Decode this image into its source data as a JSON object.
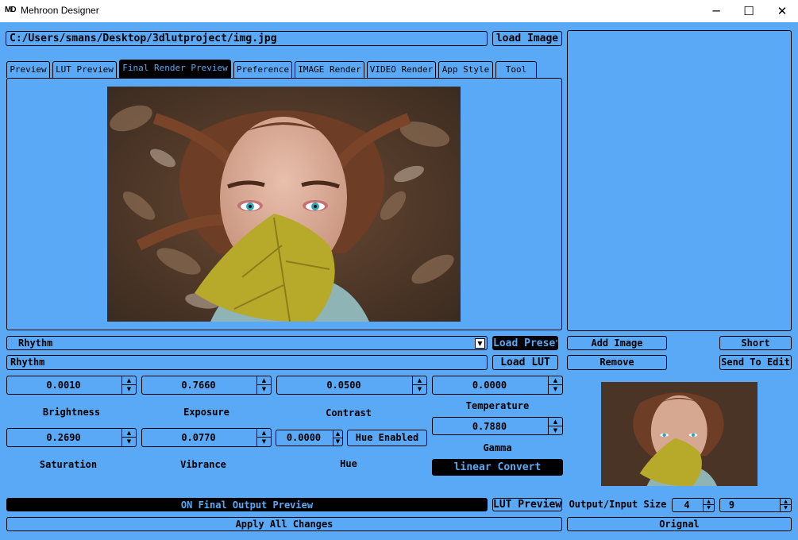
{
  "window": {
    "logo": "MD",
    "title": "Mehroon Designer",
    "minimize": "─",
    "maximize": "☐",
    "close": "✕"
  },
  "path": {
    "value": "C:/Users/smans/Desktop/3dlutproject/img.jpg",
    "load_button": "load Image"
  },
  "tabs": [
    {
      "label": "Preview"
    },
    {
      "label": "LUT Preview"
    },
    {
      "label": "Final Render Preview",
      "active": true
    },
    {
      "label": "Preference"
    },
    {
      "label": "IMAGE Render"
    },
    {
      "label": "VIDEO Render"
    },
    {
      "label": "App Style"
    },
    {
      "label": "Tool"
    }
  ],
  "preset": {
    "selected": "Rhythm",
    "load_preset": "Load Preset",
    "name_field": "Rhythm",
    "load_lut": "Load LUT"
  },
  "side_buttons": {
    "add_image": "Add Image",
    "remove": "Remove",
    "short": "Short",
    "send_to_edit": "Send To Edit"
  },
  "adjustments": {
    "brightness": {
      "label": "Brightness",
      "value": "0.0010"
    },
    "exposure": {
      "label": "Exposure",
      "value": "0.7660"
    },
    "contrast": {
      "label": "Contrast",
      "value": "0.0500"
    },
    "temperature": {
      "label": "Temperature",
      "value": "0.0000"
    },
    "saturation": {
      "label": "Saturation",
      "value": "0.2690"
    },
    "vibrance": {
      "label": "Vibrance",
      "value": "0.0770"
    },
    "hue": {
      "label": "Hue",
      "value": "0.0000"
    },
    "gamma": {
      "label": "Gamma",
      "value": "0.7880"
    },
    "hue_enabled": "Hue Enabled",
    "linear_convert": "linear Convert"
  },
  "bottom": {
    "final_output": "ON Final Output Preview",
    "lut_preview": "LUT Preview",
    "output_input_label": "Output/Input Size",
    "output_size": "4",
    "input_size": "9",
    "apply_all": "Apply All Changes",
    "original": "Orignal"
  },
  "colors": {
    "background": "#5aa9f6",
    "accent_dark": "#000000"
  },
  "icons": {
    "spin_up": "▲",
    "spin_down": "▼",
    "dropdown": "▼"
  }
}
